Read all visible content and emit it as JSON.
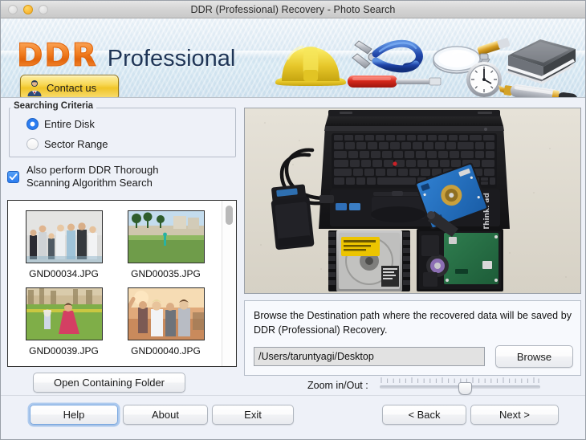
{
  "window": {
    "title": "DDR (Professional) Recovery - Photo Search",
    "traffic_lights": [
      "close-button",
      "minimize-button",
      "zoom-button"
    ]
  },
  "banner": {
    "logo_primary": "DDR",
    "logo_secondary": "Professional",
    "contact_label": "Contact us",
    "accent_orange": "#f07c1f",
    "navy": "#1f3556",
    "tool_icons": [
      "hard-hat-icon",
      "pliers-icon",
      "screwdriver-icon",
      "magnifier-icon",
      "stopwatch-icon",
      "books-icon",
      "pen-icon"
    ]
  },
  "search_criteria": {
    "group_title": "Searching Criteria",
    "options": [
      {
        "label": "Entire Disk",
        "selected": true
      },
      {
        "label": "Sector Range",
        "selected": false
      }
    ],
    "thorough_checkbox": {
      "line1": "Also perform DDR Thorough",
      "line2": "Scanning Algorithm Search",
      "checked": true
    },
    "accent_blue": "#2b7cf0"
  },
  "thumbnails": {
    "items": [
      {
        "filename": "GND00034.JPG",
        "scene": "group-of-people-outdoors"
      },
      {
        "filename": "GND00035.JPG",
        "scene": "park-lawn-with-palm-trees"
      },
      {
        "filename": "GND00039.JPG",
        "scene": "woman-and-child-in-field"
      },
      {
        "filename": "GND00040.JPG",
        "scene": "friends-celebrating-at-sunset"
      }
    ],
    "scrollbar": "vertical-scrollbar"
  },
  "preview": {
    "alt": "Laptop with disassembled hard disk drives and USB-SATA adapter"
  },
  "destination": {
    "description": "Browse the Destination path where the recovered data will be saved by DDR (Professional) Recovery.",
    "path_value": "/Users/taruntyagi/Desktop",
    "path_placeholder": "Destination path",
    "browse_label": "Browse"
  },
  "toolbar": {
    "open_folder_label": "Open Containing Folder"
  },
  "zoom": {
    "label": "Zoom in/Out :",
    "value": 49,
    "min": 0,
    "max": 100,
    "ticks": 27
  },
  "footer": {
    "help_label": "Help",
    "about_label": "About",
    "exit_label": "Exit",
    "back_label": "< Back",
    "next_label": "Next >"
  }
}
